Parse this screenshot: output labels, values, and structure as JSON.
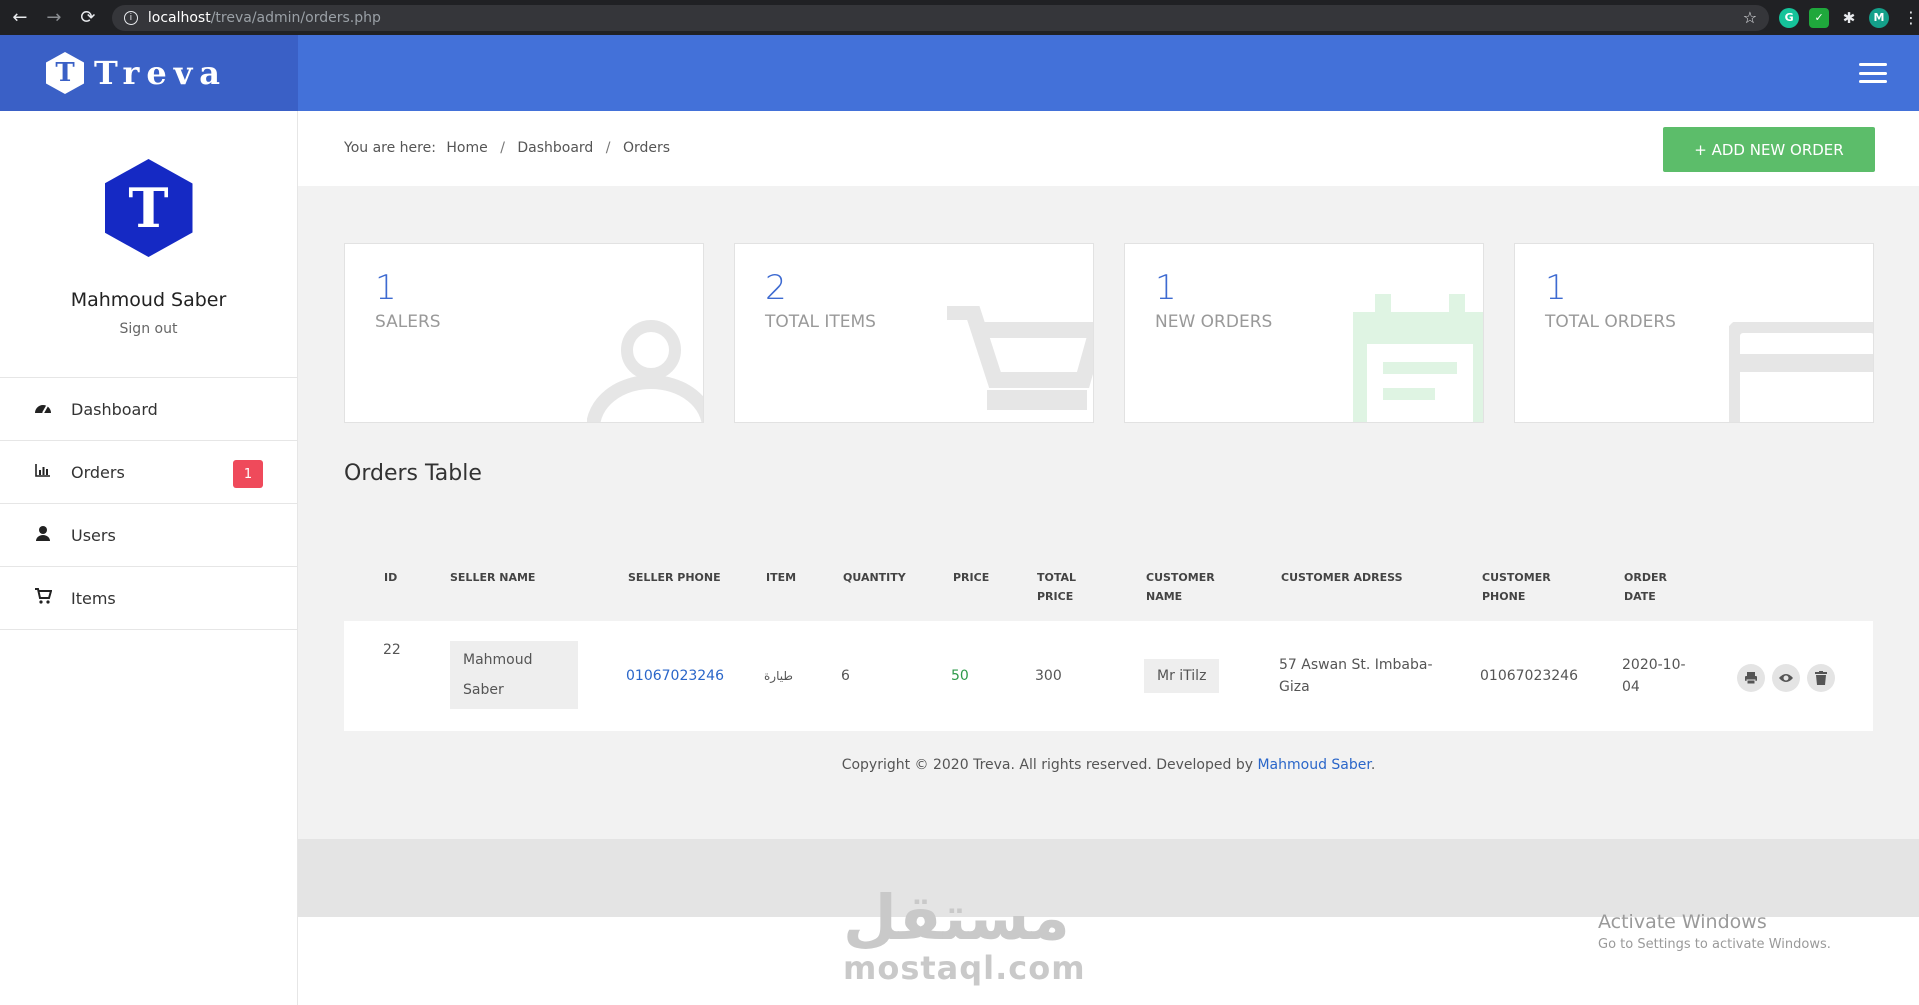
{
  "browser": {
    "url_host": "localhost",
    "url_path": "/treva/admin/orders.php",
    "profile_initial": "M",
    "ext_grammarly": "G"
  },
  "brand": {
    "logo_letter": "T",
    "name": "Treva"
  },
  "sidebar": {
    "avatar_letter": "T",
    "user_name": "Mahmoud Saber",
    "signout_label": "Sign out",
    "items": [
      {
        "label": "Dashboard",
        "icon": "dashboard-icon"
      },
      {
        "label": "Orders",
        "icon": "bar-chart-icon",
        "badge": "1"
      },
      {
        "label": "Users",
        "icon": "user-icon"
      },
      {
        "label": "Items",
        "icon": "cart-icon"
      }
    ]
  },
  "breadcrumb": {
    "prefix": "You are here:",
    "items": [
      "Home",
      "Dashboard",
      "Orders"
    ],
    "separator": "/"
  },
  "add_button_label": "+ ADD NEW ORDER",
  "stats": [
    {
      "value": "1",
      "label": "SALERS",
      "icon": "user-icon"
    },
    {
      "value": "2",
      "label": "TOTAL ITEMS",
      "icon": "cart-icon"
    },
    {
      "value": "1",
      "label": "NEW ORDERS",
      "icon": "calendar-icon"
    },
    {
      "value": "1",
      "label": "TOTAL ORDERS",
      "icon": "credit-card-icon"
    }
  ],
  "orders_table": {
    "title": "Orders Table",
    "headers": {
      "id": "ID",
      "seller_name": "SELLER NAME",
      "seller_phone": "SELLER PHONE",
      "item": "ITEM",
      "quantity": "QUANTITY",
      "price": "PRICE",
      "total_price_1": "TOTAL",
      "total_price_2": "PRICE",
      "customer_name_1": "CUSTOMER",
      "customer_name_2": "NAME",
      "customer_address": "CUSTOMER ADRESS",
      "customer_phone_1": "CUSTOMER",
      "customer_phone_2": "PHONE",
      "order_date_1": "ORDER",
      "order_date_2": "DATE"
    },
    "rows": [
      {
        "id": "22",
        "seller_name_1": "Mahmoud",
        "seller_name_2": "Saber",
        "seller_phone": "01067023246",
        "item": "طيارة",
        "quantity": "6",
        "price": "50",
        "total_price": "300",
        "customer_name": "Mr iTilz",
        "customer_address_1": "57 Aswan St. Imbaba-",
        "customer_address_2": "Giza",
        "customer_phone": "01067023246",
        "order_date_1": "2020-10-",
        "order_date_2": "04",
        "actions": [
          "print-icon",
          "eye-icon",
          "trash-icon"
        ]
      }
    ]
  },
  "footer": {
    "text": "Copyright © 2020 Treva. All rights reserved. Developed by ",
    "author_link": "Mahmoud Saber",
    "end": "."
  },
  "watermark": {
    "arabic": "مستقل",
    "latin": "mostaql.com"
  },
  "windows_notice": {
    "line1": "Activate Windows",
    "line2": "Go to Settings to activate Windows."
  },
  "colors": {
    "brand_dark": "#3a60c6",
    "topbar": "#4371d9",
    "accent_blue": "#3d6ad1",
    "add_button": "#5cbd6a",
    "badge_red": "#ef4a5b",
    "price_green": "#2e9a4a"
  }
}
